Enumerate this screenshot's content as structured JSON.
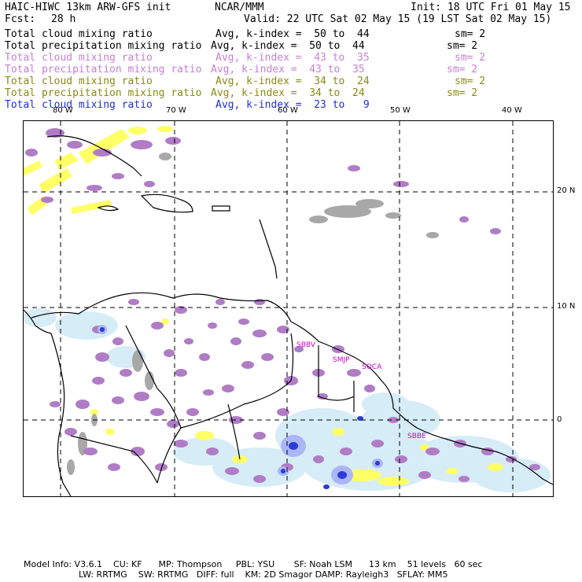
{
  "header": {
    "model_title": "HAIC-HIWC 13km ARW-GFS init",
    "org": "NCAR/MMM",
    "init": "Init: 18 UTC Fri 01 May 15",
    "fcst_label": "Fcst:",
    "fcst_value": "28 h",
    "valid": "Valid: 22 UTC Sat 02 May 15 (19 LST Sat 02 May 15)"
  },
  "legend": [
    {
      "field": "Total cloud mixing ratio",
      "avg": "Avg, k-index =  50 to  44",
      "sm": "sm= 2",
      "color": "#000000"
    },
    {
      "field": "Total precipitation mixing ratio",
      "avg": "Avg, k-index =  50 to  44",
      "sm": "sm= 2",
      "color": "#000000"
    },
    {
      "field": "Total cloud mixing ratio",
      "avg": "Avg, k-index =  43 to  35",
      "sm": "sm= 2",
      "color": "#c77fd3"
    },
    {
      "field": "Total precipitation mixing ratio",
      "avg": "Avg, k-index =  43 to  35",
      "sm": "sm= 2",
      "color": "#c77fd3"
    },
    {
      "field": "Total cloud mixing ratio",
      "avg": "Avg, k-index =  34 to  24",
      "sm": "sm= 2",
      "color": "#8a8a10"
    },
    {
      "field": "Total precipitation mixing ratio",
      "avg": "Avg, k-index =  34 to  24",
      "sm": "sm= 2",
      "color": "#8a8a10"
    },
    {
      "field": "Total cloud mixing ratio",
      "avg": "Avg, k-index =  23 to   9",
      "sm": "",
      "color": "#1f2fd6"
    }
  ],
  "map": {
    "lon_labels": [
      "80 W",
      "70 W",
      "60 W",
      "50 W",
      "40 W"
    ],
    "lat_labels": [
      "20 N",
      "10 N",
      "0"
    ],
    "stations": [
      "SBBV",
      "SMJP",
      "SOCA",
      "SBBE"
    ],
    "colors": {
      "land_outline": "#000000",
      "cloud_high": "#b07cc6",
      "cloud_mid": "#ffff66",
      "cloud_low_gray": "#a8a8a8",
      "cloud_light_blue": "#d6ecf7",
      "convective_blue": "#2b3bd8",
      "station_label": "#cc00cc"
    }
  },
  "footer": {
    "line1": "Model Info: V3.6.1    CU: KF      MP: Thompson     PBL: YSU       SF: Noah LSM      13 km    51 levels   60 sec",
    "line2": "LW: RRTMG    SW: RRTMG   DIFF: full    KM: 2D Smagor DAMP: Rayleigh3   SFLAY: MM5"
  }
}
